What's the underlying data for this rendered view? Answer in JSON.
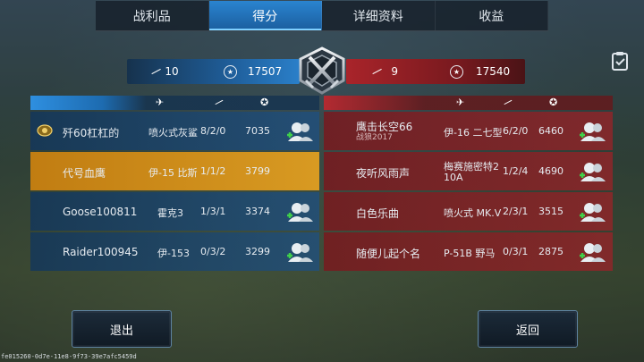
{
  "tabs": [
    {
      "label": "战利品"
    },
    {
      "label": "得分"
    },
    {
      "label": "详细资料"
    },
    {
      "label": "收益"
    }
  ],
  "header": {
    "blue_kills": "10",
    "blue_score": "17507",
    "red_kills": "9",
    "red_score": "17540"
  },
  "blue_team": [
    {
      "name": "歼60杠杠的",
      "plane": "喷火式灰鲨",
      "kda": "8/2/0",
      "score": "7035",
      "has_badge": true
    },
    {
      "name": "代号血鹰",
      "plane": "伊-15 比斯",
      "kda": "1/1/2",
      "score": "3799",
      "highlight": true
    },
    {
      "name": "Goose100811",
      "plane": "霍克3",
      "kda": "1/3/1",
      "score": "3374"
    },
    {
      "name": "Raider100945",
      "plane": "伊-153",
      "kda": "0/3/2",
      "score": "3299"
    }
  ],
  "red_team": [
    {
      "name": "鹰击长空66",
      "sub": "战狼2017",
      "plane": "伊-16 二七型",
      "kda": "6/2/0",
      "score": "6460"
    },
    {
      "name": "夜听风雨声",
      "plane_line1": "梅赛施密特2",
      "plane_line2": "10A",
      "kda": "1/2/4",
      "score": "4690"
    },
    {
      "name": "白色乐曲",
      "plane": "喷火式 MK.V",
      "kda": "2/3/1",
      "score": "3515"
    },
    {
      "name": "随便儿起个名",
      "plane": "P-51B 野马",
      "kda": "0/3/1",
      "score": "2875"
    }
  ],
  "buttons": {
    "exit": "退出",
    "back": "返回"
  },
  "footer_id": "fe015260-0d7e-11e8-9f73-39e7afc5459d",
  "colors": {
    "blue_team": "#1f5e9a",
    "red_team": "#a9242a",
    "highlight": "#d89a22",
    "tab_active": "#2a84d0"
  }
}
